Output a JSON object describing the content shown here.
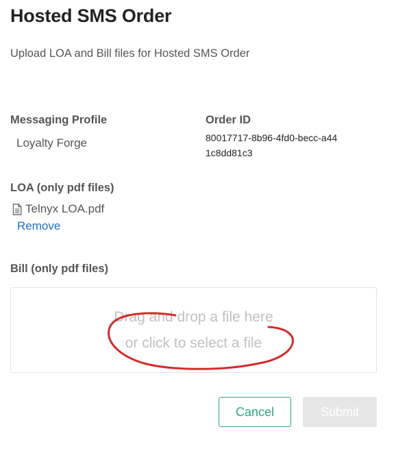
{
  "header": {
    "title": "Hosted SMS Order",
    "subtitle": "Upload LOA and Bill files for Hosted SMS Order"
  },
  "profile": {
    "label": "Messaging Profile",
    "value": "Loyalty Forge"
  },
  "order": {
    "label": "Order ID",
    "value": "80017717-8b96-4fd0-becc-a441c8dd81c3"
  },
  "loa": {
    "label": "LOA (only pdf files)",
    "file_name": "Telnyx LOA.pdf",
    "file_icon": "document-icon",
    "remove_label": "Remove"
  },
  "bill": {
    "label": "Bill (only pdf files)",
    "dropzone_line1": "Drag and drop a file here",
    "dropzone_line2": "or click to select a file"
  },
  "actions": {
    "cancel_label": "Cancel",
    "submit_label": "Submit"
  },
  "colors": {
    "link": "#1a6fc4",
    "accent": "#2aa87a",
    "annotation": "#d42a2a",
    "disabled": "#e6e6e6"
  }
}
